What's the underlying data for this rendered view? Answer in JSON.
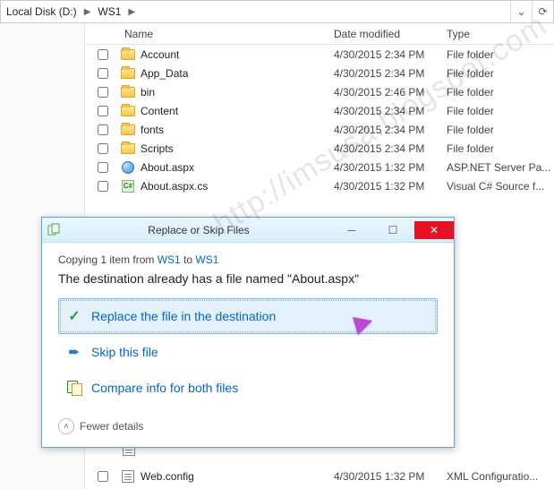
{
  "breadcrumb": {
    "disk": "Local Disk (D:)",
    "folder": "WS1"
  },
  "columns": {
    "name": "Name",
    "date": "Date modified",
    "type": "Type"
  },
  "files": [
    {
      "name": "Account",
      "date": "4/30/2015 2:34 PM",
      "type": "File folder",
      "icon": "folder"
    },
    {
      "name": "App_Data",
      "date": "4/30/2015 2:34 PM",
      "type": "File folder",
      "icon": "folder"
    },
    {
      "name": "bin",
      "date": "4/30/2015 2:46 PM",
      "type": "File folder",
      "icon": "folder"
    },
    {
      "name": "Content",
      "date": "4/30/2015 2:34 PM",
      "type": "File folder",
      "icon": "folder"
    },
    {
      "name": "fonts",
      "date": "4/30/2015 2:34 PM",
      "type": "File folder",
      "icon": "folder"
    },
    {
      "name": "Scripts",
      "date": "4/30/2015 2:34 PM",
      "type": "File folder",
      "icon": "folder"
    },
    {
      "name": "About.aspx",
      "date": "4/30/2015 1:32 PM",
      "type": "ASP.NET Server Pa...",
      "icon": "web"
    },
    {
      "name": "About.aspx.cs",
      "date": "4/30/2015 1:32 PM",
      "type": "Visual C# Source f...",
      "icon": "cs"
    }
  ],
  "bottom_file": {
    "name": "Web.config",
    "date": "4/30/2015 1:32 PM",
    "type": "XML Configuratio...",
    "icon": "cfg"
  },
  "dialog": {
    "title": "Replace or Skip Files",
    "copy_prefix": "Copying 1 item from ",
    "copy_src": "WS1",
    "copy_mid": " to ",
    "copy_dst": "WS1",
    "message": "The destination already has a file named \"About.aspx\"",
    "opt_replace": "Replace the file in the destination",
    "opt_skip": "Skip this file",
    "opt_compare": "Compare info for both files",
    "fewer": "Fewer details"
  },
  "watermark": "http://imsusa.blogspot.com"
}
